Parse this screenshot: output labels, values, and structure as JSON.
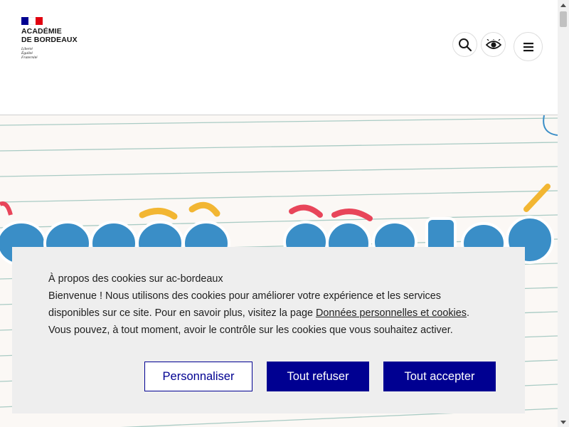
{
  "header": {
    "logo_lines": [
      "ACADÉMIE",
      "DE BORDEAUX"
    ],
    "motto": [
      "Liberté",
      "Égalité",
      "Fraternité"
    ],
    "flag_colors": [
      "#000091",
      "#ffffff",
      "#e1000f"
    ],
    "buttons": [
      {
        "name": "search-button",
        "icon": "search-icon"
      },
      {
        "name": "accessibility-button",
        "icon": "eye-icon"
      },
      {
        "name": "menu-button",
        "icon": "hamburger-icon"
      }
    ]
  },
  "hero": {
    "line_color": "#a7c7c0",
    "letter_color": "#3a8ec7",
    "accent_colors": [
      "#e8455a",
      "#f2b632"
    ]
  },
  "cookie_banner": {
    "title": "À propos des cookies sur ac-bordeaux",
    "text_before_link": "Bienvenue ! Nous utilisons des cookies pour améliorer votre expérience et les services disponibles sur ce site. Pour en savoir plus, visitez la page ",
    "link_text": "Données personnelles et cookies",
    "text_after_link": ".",
    "text_second": "Vous pouvez, à tout moment, avoir le contrôle sur les cookies que vous souhaitez activer.",
    "buttons": {
      "customize": "Personnaliser",
      "refuse": "Tout refuser",
      "accept": "Tout accepter"
    },
    "primary_color": "#000091"
  }
}
